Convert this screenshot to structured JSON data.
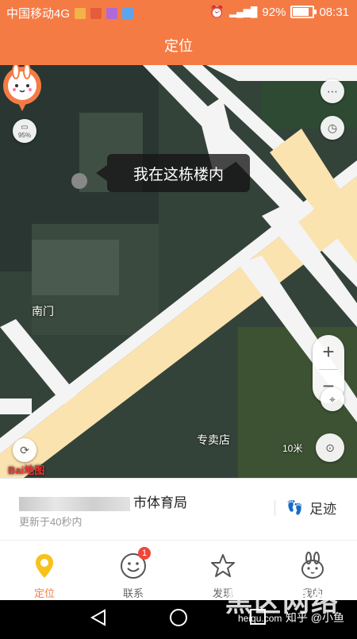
{
  "status_bar": {
    "carrier": "中国移动4G",
    "battery": "92%",
    "battery_level": 0.92,
    "time": "08:31",
    "network": "4G"
  },
  "title": "定位",
  "map": {
    "bubble_text": "我在这栋楼内",
    "labels": {
      "south_gate": "南门",
      "scale": "10米",
      "logo": "Bai地图",
      "store": "专卖店",
      "battery_small": "95%"
    }
  },
  "location_card": {
    "place": "市体育局",
    "updated": "更新于40秒内",
    "footprint": "足迹"
  },
  "tabs": [
    {
      "label": "定位",
      "icon": "location-pin-icon",
      "active": true
    },
    {
      "label": "联系",
      "icon": "smiley-face-icon",
      "badge": "1"
    },
    {
      "label": "发现",
      "icon": "star-icon"
    },
    {
      "label": "我的",
      "icon": "bunny-face-icon"
    }
  ],
  "watermark": {
    "text": "知乎 @小鱼",
    "logo": "黑区网络",
    "logo_sub": "heiqu.com"
  },
  "colors": {
    "accent": "#f57b45",
    "road": "#fbe3b0",
    "road_white": "#ffffff"
  }
}
